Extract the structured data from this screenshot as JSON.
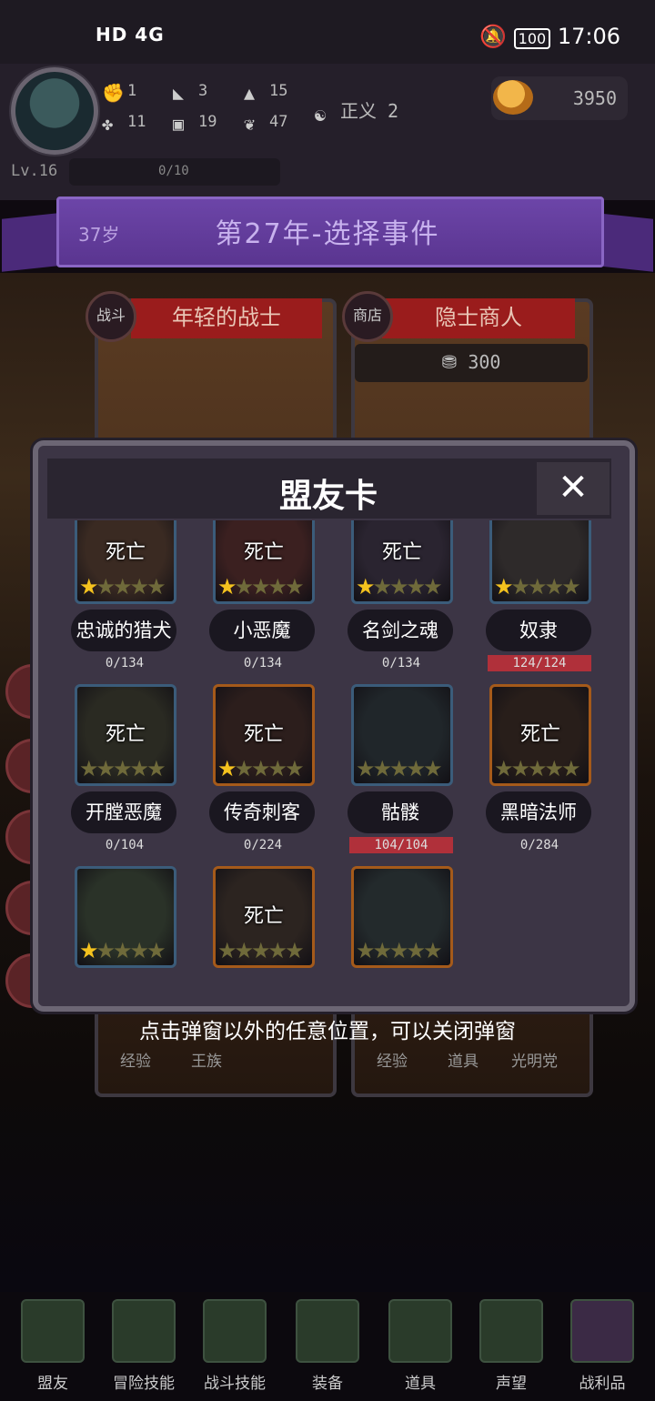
{
  "status_bar": {
    "left": "HD 4G",
    "time": "17:06",
    "battery": "100"
  },
  "header": {
    "stats": [
      {
        "icon": "fist-icon",
        "value": "1"
      },
      {
        "icon": "boot-icon",
        "value": "3"
      },
      {
        "icon": "wizard-hat-icon",
        "value": "15"
      },
      {
        "icon": "clover-icon",
        "value": "11"
      },
      {
        "icon": "armor-icon",
        "value": "19"
      },
      {
        "icon": "lotus-icon",
        "value": "47"
      }
    ],
    "alignment": "正义 2",
    "coins": "3950",
    "level": "Lv.16",
    "exp": "0/10"
  },
  "banner": {
    "age": "37岁",
    "title": "第27年-选择事件"
  },
  "events": [
    {
      "badge": "战斗",
      "title": "年轻的战士"
    },
    {
      "badge": "商店",
      "title": "隐士商人",
      "price": "300"
    }
  ],
  "bottom_labels": [
    "经验",
    "王族",
    "经验",
    "道具",
    "光明党"
  ],
  "hint": "点击弹窗以外的任意位置，可以关闭弹窗",
  "modal": {
    "title": "盟友卡",
    "close": "✕",
    "cards": [
      {
        "name": "忠诚的猎犬",
        "count": "0/134",
        "dead": "死亡",
        "stars": 1,
        "full": false,
        "frame": "blue"
      },
      {
        "name": "小恶魔",
        "count": "0/134",
        "dead": "死亡",
        "stars": 1,
        "full": false,
        "frame": "blue"
      },
      {
        "name": "名剑之魂",
        "count": "0/134",
        "dead": "死亡",
        "stars": 1,
        "full": false,
        "frame": "blue"
      },
      {
        "name": "奴隶",
        "count": "124/124",
        "dead": "",
        "stars": 1,
        "full": true,
        "frame": "blue"
      },
      {
        "name": "开膛恶魔",
        "count": "0/104",
        "dead": "死亡",
        "stars": 0,
        "full": false,
        "frame": "blue"
      },
      {
        "name": "传奇刺客",
        "count": "0/224",
        "dead": "死亡",
        "stars": 1,
        "full": false,
        "frame": "gold"
      },
      {
        "name": "骷髅",
        "count": "104/104",
        "dead": "",
        "stars": 0,
        "full": true,
        "frame": "blue"
      },
      {
        "name": "黑暗法师",
        "count": "0/284",
        "dead": "死亡",
        "stars": 0,
        "full": false,
        "frame": "gold"
      },
      {
        "name": "",
        "count": "",
        "dead": "",
        "stars": 1,
        "full": false,
        "frame": "blue"
      },
      {
        "name": "",
        "count": "",
        "dead": "死亡",
        "stars": 0,
        "full": false,
        "frame": "gold"
      },
      {
        "name": "",
        "count": "",
        "dead": "",
        "stars": 0,
        "full": false,
        "frame": "gold"
      }
    ]
  },
  "nav": [
    {
      "label": "盟友",
      "icon": "allies-icon"
    },
    {
      "label": "冒险技能",
      "icon": "adventure-book-icon"
    },
    {
      "label": "战斗技能",
      "icon": "backpack-icon"
    },
    {
      "label": "装备",
      "icon": "crossed-swords-icon"
    },
    {
      "label": "道具",
      "icon": "pouch-icon"
    },
    {
      "label": "声望",
      "icon": "scroll-icon"
    },
    {
      "label": "战利品",
      "icon": "treasure-chest-icon"
    }
  ],
  "colors": {
    "accent": "#6c45a8",
    "event_red": "#9a1c1c",
    "star": "#f4c21e",
    "full_count": "#b0303a"
  }
}
